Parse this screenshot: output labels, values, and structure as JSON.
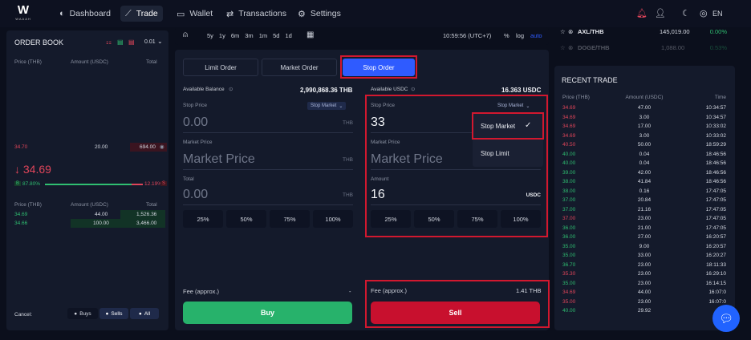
{
  "nav": {
    "logo_mark": "W",
    "logo_text": "WAAAH",
    "items": [
      {
        "label": "Dashboard",
        "icon": "dashboard-icon",
        "glyph": "◐"
      },
      {
        "label": "Trade",
        "icon": "chart-icon",
        "glyph": "⟋"
      },
      {
        "label": "Wallet",
        "icon": "wallet-icon",
        "glyph": "▭"
      },
      {
        "label": "Transactions",
        "icon": "transfer-icon",
        "glyph": "⇄"
      },
      {
        "label": "Settings",
        "icon": "gear-icon",
        "glyph": "⚙"
      }
    ],
    "lang": "EN"
  },
  "orderbook": {
    "title": "ORDER BOOK",
    "precision": "0.01",
    "headers": [
      "Price (THB)",
      "Amount (USDC)",
      "Total"
    ],
    "ask_row": {
      "price": "34.70",
      "amount": "20.00",
      "total": "694.00"
    },
    "last_price": "↓ 34.69",
    "buy_pct": "87.80%",
    "sell_pct": "12.19%",
    "buy_letter": "B",
    "sell_letter": "S",
    "bid_headers": [
      "Price (THB)",
      "Amount (USDC)",
      "Total"
    ],
    "bids": [
      {
        "price": "34.69",
        "amount": "44.00",
        "total": "1,526.36"
      },
      {
        "price": "34.66",
        "amount": "100.00",
        "total": "3,466.00"
      }
    ],
    "cancel_label": "Cancel:",
    "cancel_buys": "Buys",
    "cancel_sells": "Sells",
    "cancel_all": "All"
  },
  "chartbar": {
    "ranges": [
      "5y",
      "1y",
      "6m",
      "3m",
      "1m",
      "5d",
      "1d"
    ],
    "time": "10:59:56 (UTC+7)",
    "pct": "%",
    "log": "log",
    "auto": "auto"
  },
  "tabs": [
    "Limit Order",
    "Market Order",
    "Stop Order"
  ],
  "buy_form": {
    "balance_label": "Available Balance",
    "balance_value": "2,990,868.36 THB",
    "stop_price_label": "Stop Price",
    "stop_select": "Stop Market",
    "stop_placeholder": "0.00",
    "stop_unit": "THB",
    "market_label": "Market Price",
    "market_placeholder": "Market Price",
    "market_unit": "THB",
    "total_label": "Total",
    "total_placeholder": "0.00",
    "total_unit": "THB",
    "percents": [
      "25%",
      "50%",
      "75%",
      "100%"
    ],
    "fee_label": "Fee (approx.)",
    "fee_value": "-",
    "button": "Buy"
  },
  "sell_form": {
    "balance_label": "Available USDC",
    "balance_value": "16.363 USDC",
    "stop_price_label": "Stop Price",
    "stop_select": "Stop Market",
    "stop_value": "33",
    "market_label": "Market Price",
    "market_placeholder": "Market Price",
    "amount_label": "Amount",
    "amount_value": "16",
    "amount_unit": "USDC",
    "percents": [
      "25%",
      "50%",
      "75%",
      "100%"
    ],
    "fee_label": "Fee (approx.)",
    "fee_value": "1.41 THB",
    "button": "Sell"
  },
  "dropdown": {
    "options": [
      "Stop Market",
      "Stop Limit"
    ],
    "selected": "Stop Market"
  },
  "watchlist": [
    {
      "symbol": "AXL/THB",
      "price": "145,019.00",
      "change": "0.00%"
    },
    {
      "symbol": "DOGE/THB",
      "price": "1,088.00",
      "change": "0.53%"
    }
  ],
  "recent_trade": {
    "title": "RECENT TRADE",
    "headers": [
      "Price (THB)",
      "Amount (USDC)",
      "Time"
    ],
    "rows": [
      {
        "p": "34.69",
        "a": "47.00",
        "t": "10:34:57",
        "s": "red"
      },
      {
        "p": "34.69",
        "a": "3.00",
        "t": "10:34:57",
        "s": "red"
      },
      {
        "p": "34.69",
        "a": "17.00",
        "t": "10:33:02",
        "s": "red"
      },
      {
        "p": "34.69",
        "a": "3.00",
        "t": "10:33:02",
        "s": "red"
      },
      {
        "p": "40.50",
        "a": "50.00",
        "t": "18:59:29",
        "s": "red"
      },
      {
        "p": "40.00",
        "a": "0.04",
        "t": "18:46:56",
        "s": "green"
      },
      {
        "p": "40.00",
        "a": "0.04",
        "t": "18:46:56",
        "s": "green"
      },
      {
        "p": "39.00",
        "a": "42.00",
        "t": "18:46:56",
        "s": "green"
      },
      {
        "p": "38.00",
        "a": "41.84",
        "t": "18:46:56",
        "s": "green"
      },
      {
        "p": "38.00",
        "a": "0.16",
        "t": "17:47:05",
        "s": "green"
      },
      {
        "p": "37.00",
        "a": "20.84",
        "t": "17:47:05",
        "s": "green"
      },
      {
        "p": "37.00",
        "a": "21.16",
        "t": "17:47:05",
        "s": "green"
      },
      {
        "p": "37.00",
        "a": "23.00",
        "t": "17:47:05",
        "s": "red"
      },
      {
        "p": "36.00",
        "a": "21.00",
        "t": "17:47:05",
        "s": "green"
      },
      {
        "p": "36.00",
        "a": "27.00",
        "t": "16:20:57",
        "s": "green"
      },
      {
        "p": "35.00",
        "a": "9.00",
        "t": "16:20:57",
        "s": "green"
      },
      {
        "p": "35.00",
        "a": "33.00",
        "t": "16:20:27",
        "s": "green"
      },
      {
        "p": "36.70",
        "a": "23.00",
        "t": "18:11:33",
        "s": "green"
      },
      {
        "p": "35.30",
        "a": "23.00",
        "t": "16:29:10",
        "s": "red"
      },
      {
        "p": "35.00",
        "a": "23.00",
        "t": "16:14:15",
        "s": "green"
      },
      {
        "p": "34.69",
        "a": "44.00",
        "t": "16:07:0",
        "s": "red"
      },
      {
        "p": "35.00",
        "a": "23.00",
        "t": "16:07:0",
        "s": "red"
      },
      {
        "p": "40.00",
        "a": "29.92",
        "t": "15:5",
        "s": "green"
      }
    ]
  },
  "colors": {
    "accent": "#2f5bff",
    "buy": "#27b26b",
    "sell": "#c8102e",
    "highlight": "#d2182f"
  }
}
